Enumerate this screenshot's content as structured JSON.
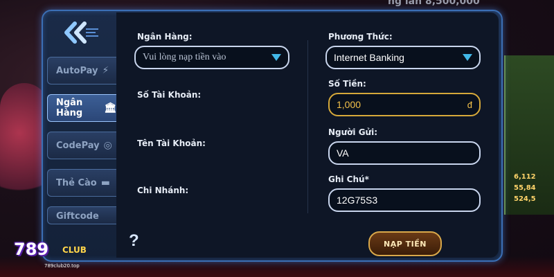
{
  "background": {
    "top_text": "ng lần 8,500,000",
    "right_values": [
      "6,112",
      "55,84",
      "524,5"
    ]
  },
  "sidebar": {
    "items": [
      {
        "label": "AutoPay",
        "icon": "bolt-icon"
      },
      {
        "label": "Ngân Hàng",
        "icon": "bank-icon"
      },
      {
        "label": "CodePay",
        "icon": "coin-icon"
      },
      {
        "label": "Thẻ Cào",
        "icon": "card-icon"
      },
      {
        "label": "Giftcode",
        "icon": "gift-icon"
      }
    ]
  },
  "form": {
    "bank": {
      "label": "Ngân Hàng:",
      "placeholder": "Vui lòng nạp tiền vào"
    },
    "account_number": {
      "label": "Số Tài Khoản:"
    },
    "account_name": {
      "label": "Tên Tài Khoản:"
    },
    "branch": {
      "label": "Chi Nhánh:"
    },
    "method": {
      "label": "Phương Thức:",
      "value": "Internet Banking"
    },
    "amount": {
      "label": "Số Tiền:",
      "value": "1,000",
      "currency": "đ"
    },
    "sender": {
      "label": "Người Gửi:",
      "value": "VA"
    },
    "note": {
      "label": "Ghi Chú*",
      "value": "12G75S3"
    }
  },
  "actions": {
    "help": "?",
    "submit_label": "NẠP TIỀN"
  },
  "logo": {
    "main": "789",
    "club": "CLUB",
    "url": "789club20.top"
  },
  "colors": {
    "accent_blue": "#3b6fb5",
    "gold": "#d6a93a",
    "dropdown_caret": "#42b8e8"
  }
}
